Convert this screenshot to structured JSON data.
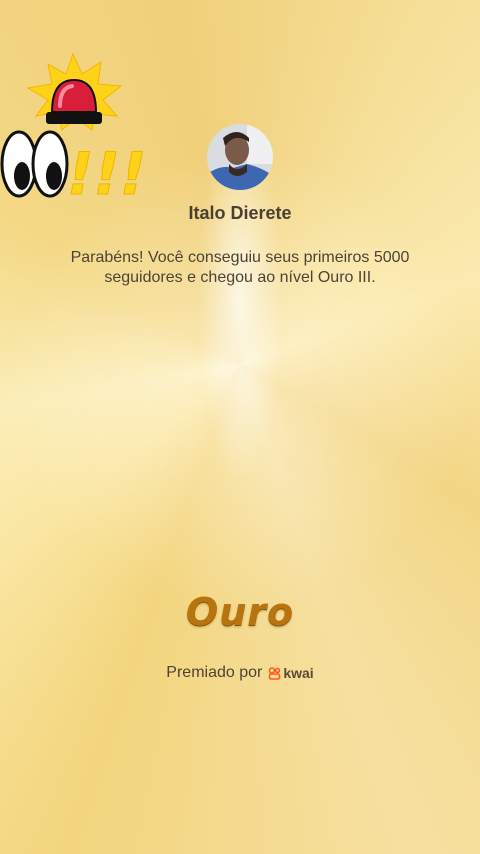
{
  "user": {
    "name": "Italo Dierete",
    "avatar_icon": "user-avatar-photo"
  },
  "message": "Parabéns! Você conseguiu seus primeiros 5000 seguidores e chegou ao nível Ouro III.",
  "badge": {
    "title": "Ouro"
  },
  "awarded_by": {
    "label": "Premiado por",
    "brand": "kwai",
    "brand_icon": "kwai-logo-icon"
  },
  "sticker": {
    "icon": "alarm-siren-eyes-sticker",
    "text": "!!!"
  },
  "colors": {
    "background": "#f6df92",
    "badge_title": "#b8740e",
    "kwai_brand": "#ff5a1f"
  }
}
